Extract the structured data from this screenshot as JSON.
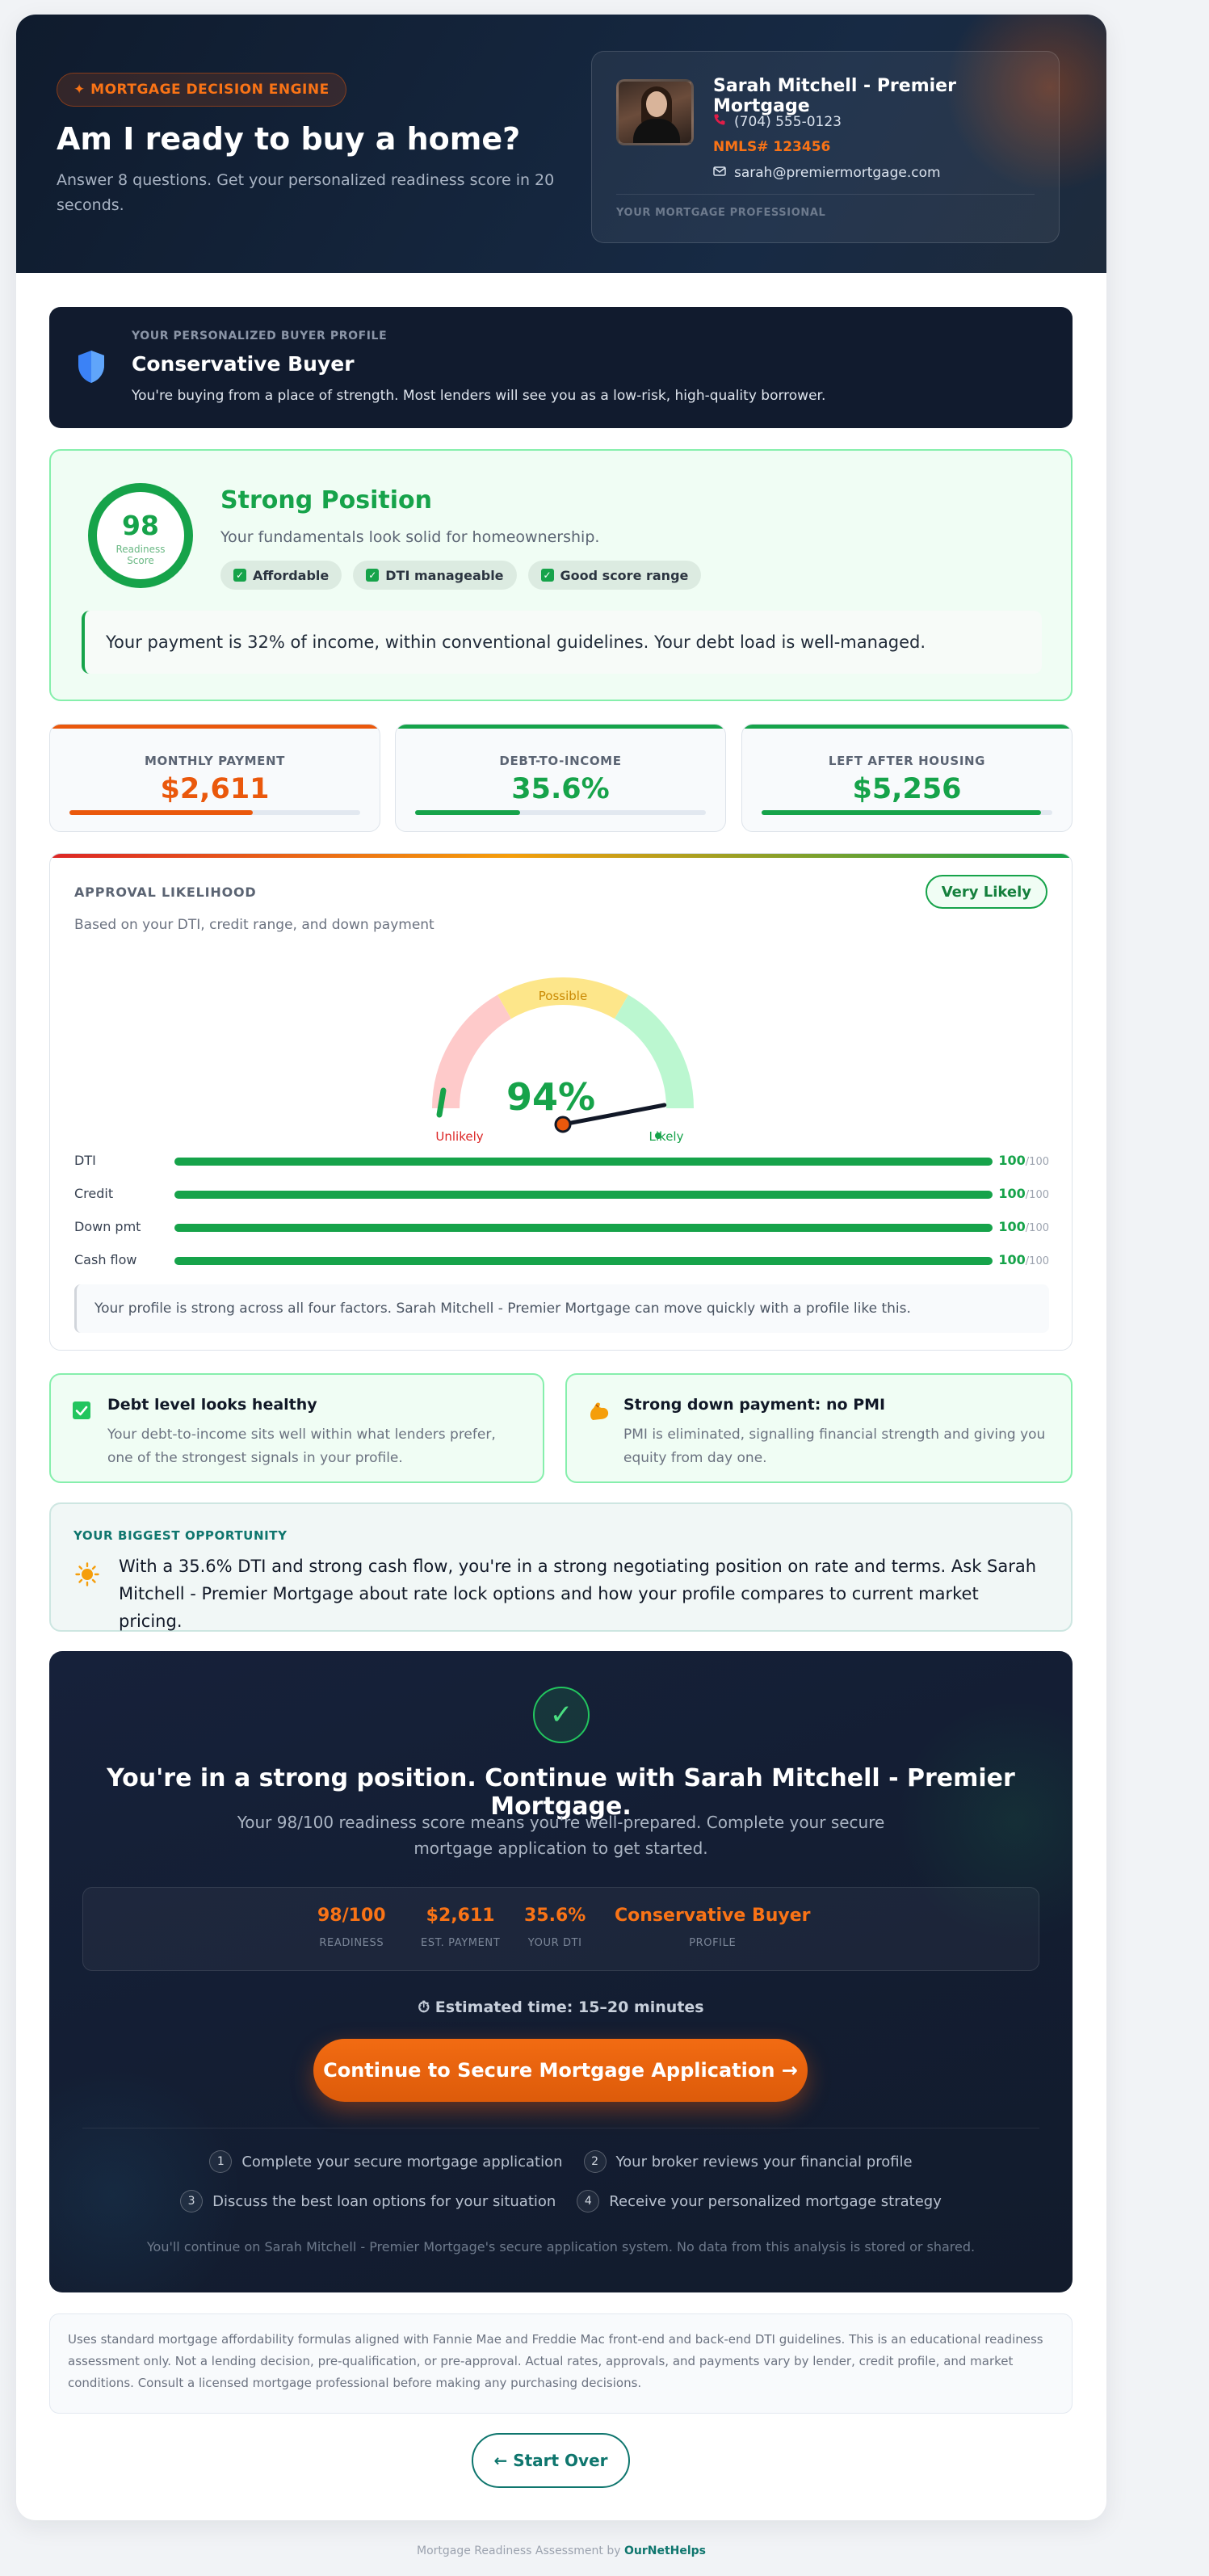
{
  "header": {
    "badge": "✦ MORTGAGE DECISION ENGINE",
    "title": "Am I ready to buy a home?",
    "subtitle": "Answer 8 questions. Get your personalized readiness score in 20 seconds."
  },
  "broker": {
    "name": "Sarah Mitchell - Premier Mortgage",
    "phone": "(704) 555-0123",
    "nmls": "NMLS# 123456",
    "email": "sarah@premiermortgage.com",
    "caption": "YOUR MORTGAGE PROFESSIONAL"
  },
  "profile": {
    "eyebrow": "YOUR PERSONALIZED BUYER PROFILE",
    "title": "Conservative Buyer",
    "description": "You're buying from a place of strength. Most lenders will see you as a low-risk, high-quality borrower."
  },
  "score": {
    "value": "98",
    "label": "Readiness Score",
    "title": "Strong Position",
    "description": "Your fundamentals look solid for homeownership.",
    "chips": [
      "Affordable",
      "DTI manageable",
      "Good score range"
    ],
    "insight": "Your payment is 32% of income, within conventional guidelines. Your debt load is well-managed."
  },
  "metrics": [
    {
      "label": "MONTHLY PAYMENT",
      "value": "$2,611",
      "color": "#ea580c",
      "fill": 0.63
    },
    {
      "label": "DEBT-TO-INCOME",
      "value": "35.6%",
      "color": "#16a34a",
      "fill": 0.36
    },
    {
      "label": "LEFT AFTER HOUSING",
      "value": "$5,256",
      "color": "#16a34a",
      "fill": 0.96
    }
  ],
  "approval": {
    "title": "APPROVAL LIKELIHOOD",
    "subtitle": "Based on your DTI, credit range, and down payment",
    "pill": "Very Likely",
    "gauge": {
      "percent": "94%",
      "value": 94,
      "low": "Unlikely",
      "mid": "Possible",
      "high": "Likely"
    },
    "factors": [
      {
        "label": "DTI",
        "score": "100",
        "max": "/100",
        "value": 100
      },
      {
        "label": "Credit",
        "score": "100",
        "max": "/100",
        "value": 100
      },
      {
        "label": "Down pmt",
        "score": "100",
        "max": "/100",
        "value": 100
      },
      {
        "label": "Cash flow",
        "score": "100",
        "max": "/100",
        "value": 100
      }
    ],
    "note": "Your profile is strong across all four factors. Sarah Mitchell - Premier Mortgage can move quickly with a profile like this."
  },
  "highlights": [
    {
      "title": "Debt level looks healthy",
      "description": "Your debt-to-income sits well within what lenders prefer, one of the strongest signals in your profile.",
      "icon": "check-icon"
    },
    {
      "title": "Strong down payment: no PMI",
      "description": "PMI is eliminated, signalling financial strength and giving you equity from day one.",
      "icon": "flexed-arm-icon"
    }
  ],
  "opportunity": {
    "eyebrow": "YOUR BIGGEST OPPORTUNITY",
    "text": "With a 35.6% DTI and strong cash flow, you're in a strong negotiating position on rate and terms. Ask Sarah Mitchell - Premier Mortgage about rate lock options and how your profile compares to current market pricing."
  },
  "cta": {
    "title": "You're in a strong position. Continue with Sarah Mitchell - Premier Mortgage.",
    "subtitle": "Your 98/100 readiness score means you're well-prepared. Complete your secure mortgage application to get started.",
    "stats": [
      {
        "value": "98/100",
        "label": "READINESS"
      },
      {
        "value": "$2,611",
        "label": "EST. PAYMENT"
      },
      {
        "value": "35.6%",
        "label": "YOUR DTI"
      },
      {
        "value": "Conservative Buyer",
        "label": "PROFILE"
      }
    ],
    "estimate": "⏱ Estimated time: 15–20 minutes",
    "button": "Continue to Secure Mortgage Application →",
    "steps": [
      {
        "n": "1",
        "text": "Complete your secure mortgage application"
      },
      {
        "n": "2",
        "text": "Your broker reviews your financial profile"
      },
      {
        "n": "3",
        "text": "Discuss the best loan options for your situation"
      },
      {
        "n": "4",
        "text": "Receive your personalized mortgage strategy"
      }
    ],
    "fine": "You'll continue on Sarah Mitchell - Premier Mortgage's secure application system. No data from this analysis is stored or shared."
  },
  "disclaimer": "Uses standard mortgage affordability formulas aligned with Fannie Mae and Freddie Mac front-end and back-end DTI guidelines. This is an educational readiness assessment only. Not a lending decision, pre-qualification, or pre-approval. Actual rates, approvals, and payments vary by lender, credit profile, and market conditions. Consult a licensed mortgage professional before making any purchasing decisions.",
  "restart": "← Start Over",
  "footer": {
    "text": "Mortgage Readiness Assessment by",
    "brand": "OurNetHelps"
  }
}
